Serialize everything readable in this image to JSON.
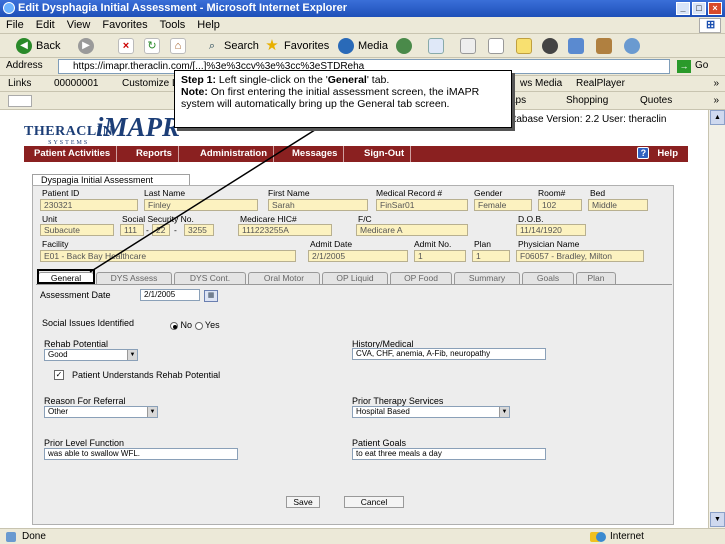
{
  "window": {
    "title": "Edit Dysphagia Initial Assessment - Microsoft Internet Explorer"
  },
  "menu": [
    "File",
    "Edit",
    "View",
    "Favorites",
    "Tools",
    "Help"
  ],
  "toolbar": {
    "back": "Back",
    "search": "Search",
    "favorites": "Favorites",
    "media": "Media"
  },
  "address": {
    "label": "Address",
    "url": "https://imapr.theraclin.com/[...]%3e%3ccv%3e%3cc%3eSTDReha",
    "go": "Go"
  },
  "links": {
    "label": "Links",
    "items": [
      "00000001",
      "Customize Li"
    ],
    "right": [
      "ws Media",
      "RealPlayer"
    ]
  },
  "links2": {
    "items": [
      "aps",
      "Shopping",
      "Quotes"
    ]
  },
  "callout": {
    "step": "Step 1:",
    "step_text": " Left single-click on the '",
    "general": "General",
    "step_end": "' tab.",
    "note": "Note:",
    "note_text": " On first entering the initial assessment screen, the iMAPR system will automatically bring up the General tab screen."
  },
  "logo": {
    "brand": "THERACLIN",
    "sub": "SYSTEMS",
    "app": "iMAPR"
  },
  "db_version": "atabase Version: 2.2 User: theraclin",
  "nav": {
    "items": [
      "Patient Activities",
      "Reports",
      "Administration",
      "Messages",
      "Sign-Out"
    ],
    "help": "Help"
  },
  "form_tab": "Dyspagia Initial Assessment",
  "patient": {
    "labels": {
      "id": "Patient ID",
      "last": "Last Name",
      "first": "First Name",
      "mrn": "Medical Record #",
      "gender": "Gender",
      "room": "Room#",
      "bed": "Bed",
      "unit": "Unit",
      "ssn": "Social Security No.",
      "medicare": "Medicare HIC#",
      "fc": "F/C",
      "dob": "D.O.B.",
      "facility": "Facility",
      "admit_date": "Admit Date",
      "admit_no": "Admit No.",
      "plan": "Plan",
      "physician": "Physician Name"
    },
    "values": {
      "id": "230321",
      "last": "Finley",
      "first": "Sarah",
      "mrn": "FinSar01",
      "gender": "Female",
      "room": "102",
      "bed": "Middle",
      "unit": "Subacute",
      "ssn1": "111",
      "ssn2": "22",
      "ssn3": "3255",
      "medicare": "111223255A",
      "fc": "Medicare A",
      "dob": "11/14/1920",
      "facility": "E01 - Back Bay Healthcare",
      "admit_date": "2/1/2005",
      "admit_no": "1",
      "plan": "1",
      "physician": "F06057 - Bradley, Milton"
    }
  },
  "tabs": [
    "General",
    "DYS Assess",
    "DYS Cont.",
    "Oral Motor",
    "OP Liquid",
    "OP Food",
    "Summary",
    "Goals",
    "Plan"
  ],
  "general": {
    "assessment_date_label": "Assessment Date",
    "assessment_date": "2/1/2005",
    "social_label": "Social Issues Identified",
    "no": "No",
    "yes": "Yes",
    "rehab_potential_label": "Rehab Potential",
    "rehab_potential": "Good",
    "history_label": "History/Medical",
    "history": "CVA, CHF, anemia, A-Fib, neuropathy",
    "understands_label": "Patient Understands Rehab Potential",
    "referral_label": "Reason For Referral",
    "referral": "Other",
    "prior_therapy_label": "Prior Therapy Services",
    "prior_therapy": "Hospital Based",
    "prior_level_label": "Prior Level Function",
    "prior_level": "was able to swallow WFL.",
    "goals_label": "Patient Goals",
    "goals": "to eat three meals a day",
    "save": "Save",
    "cancel": "Cancel"
  },
  "status": {
    "left": "Done",
    "right": "Internet"
  }
}
